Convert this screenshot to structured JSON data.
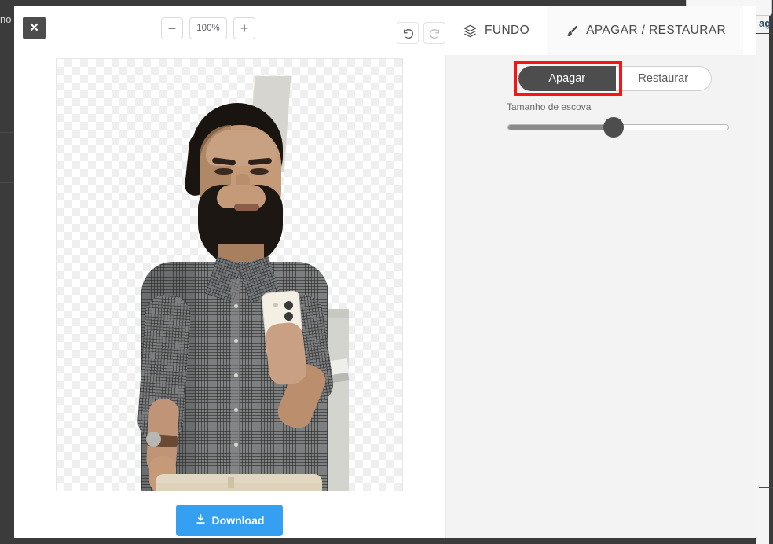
{
  "background_page": {
    "ghost_left_text": "no",
    "link_text": "ag",
    "card_label": ""
  },
  "modal": {
    "close_label": "✕",
    "toolbar": {
      "zoom_out_label": "−",
      "zoom_level": "100%",
      "zoom_in_label": "+",
      "undo_name": "undo-icon",
      "redo_name": "redo-icon"
    },
    "tabs": [
      {
        "label": "FUNDO",
        "icon": "layers-icon",
        "active": false
      },
      {
        "label": "APAGAR / RESTAURAR",
        "icon": "brush-icon",
        "active": true
      }
    ],
    "canvas": {
      "transparency": "checkerboard",
      "image_description": "man taking mirror selfie with phone, background removed"
    },
    "download_label": "Download",
    "download_icon": "download-icon",
    "download_color": "#35a0f2"
  },
  "right_panel": {
    "mode_buttons": [
      {
        "label": "Apagar",
        "active": true
      },
      {
        "label": "Restaurar",
        "active": false
      }
    ],
    "highlight_color": "#f91414",
    "brush_size_label": "Tamanho de escova",
    "brush_size_percent": 48
  }
}
